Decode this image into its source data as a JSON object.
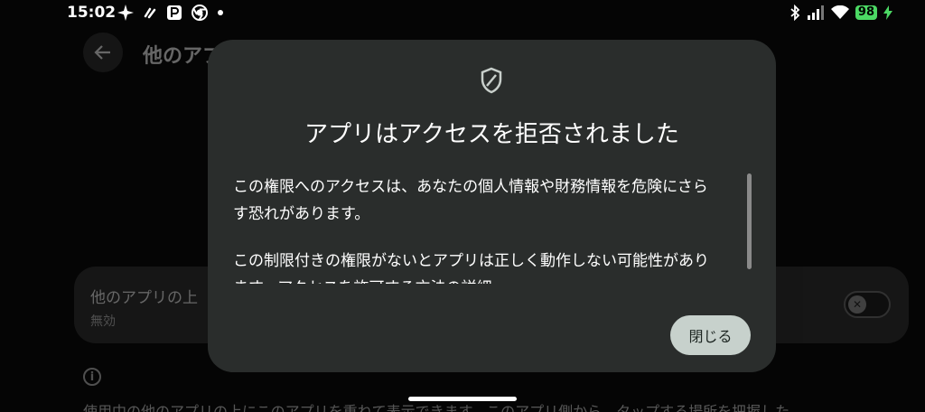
{
  "status_bar": {
    "time": "15:02",
    "battery": "98",
    "left_icons": [
      "sparkle-icon",
      "link-icon",
      "p-app-icon",
      "chrome-icon",
      "dot-icon"
    ],
    "right_icons": [
      "bluetooth-icon",
      "signal-icon",
      "wifi-icon",
      "battery-icon",
      "charging-icon"
    ]
  },
  "background_page": {
    "title": "他のアプ",
    "setting": {
      "title": "他のアプリの上",
      "status": "無効"
    },
    "description": "使用中の他のアプリの上にこのアプリを重ねて表示できます。このアプリ側から、タップする場所を把握した"
  },
  "dialog": {
    "title": "アプリはアクセスを拒否されました",
    "paragraph1": "この権限へのアクセスは、あなたの個人情報や財務情報を危険にさらす恐れがあります。",
    "paragraph2": "この制限付きの権限がないとアプリは正しく動作しない可能性があります。アクセスを許可する方法の詳細",
    "close_label": "閉じる"
  },
  "colors": {
    "dialog_bg": "#2a2d2c",
    "button_bg": "#c7d1cc",
    "battery": "#4cd964"
  }
}
